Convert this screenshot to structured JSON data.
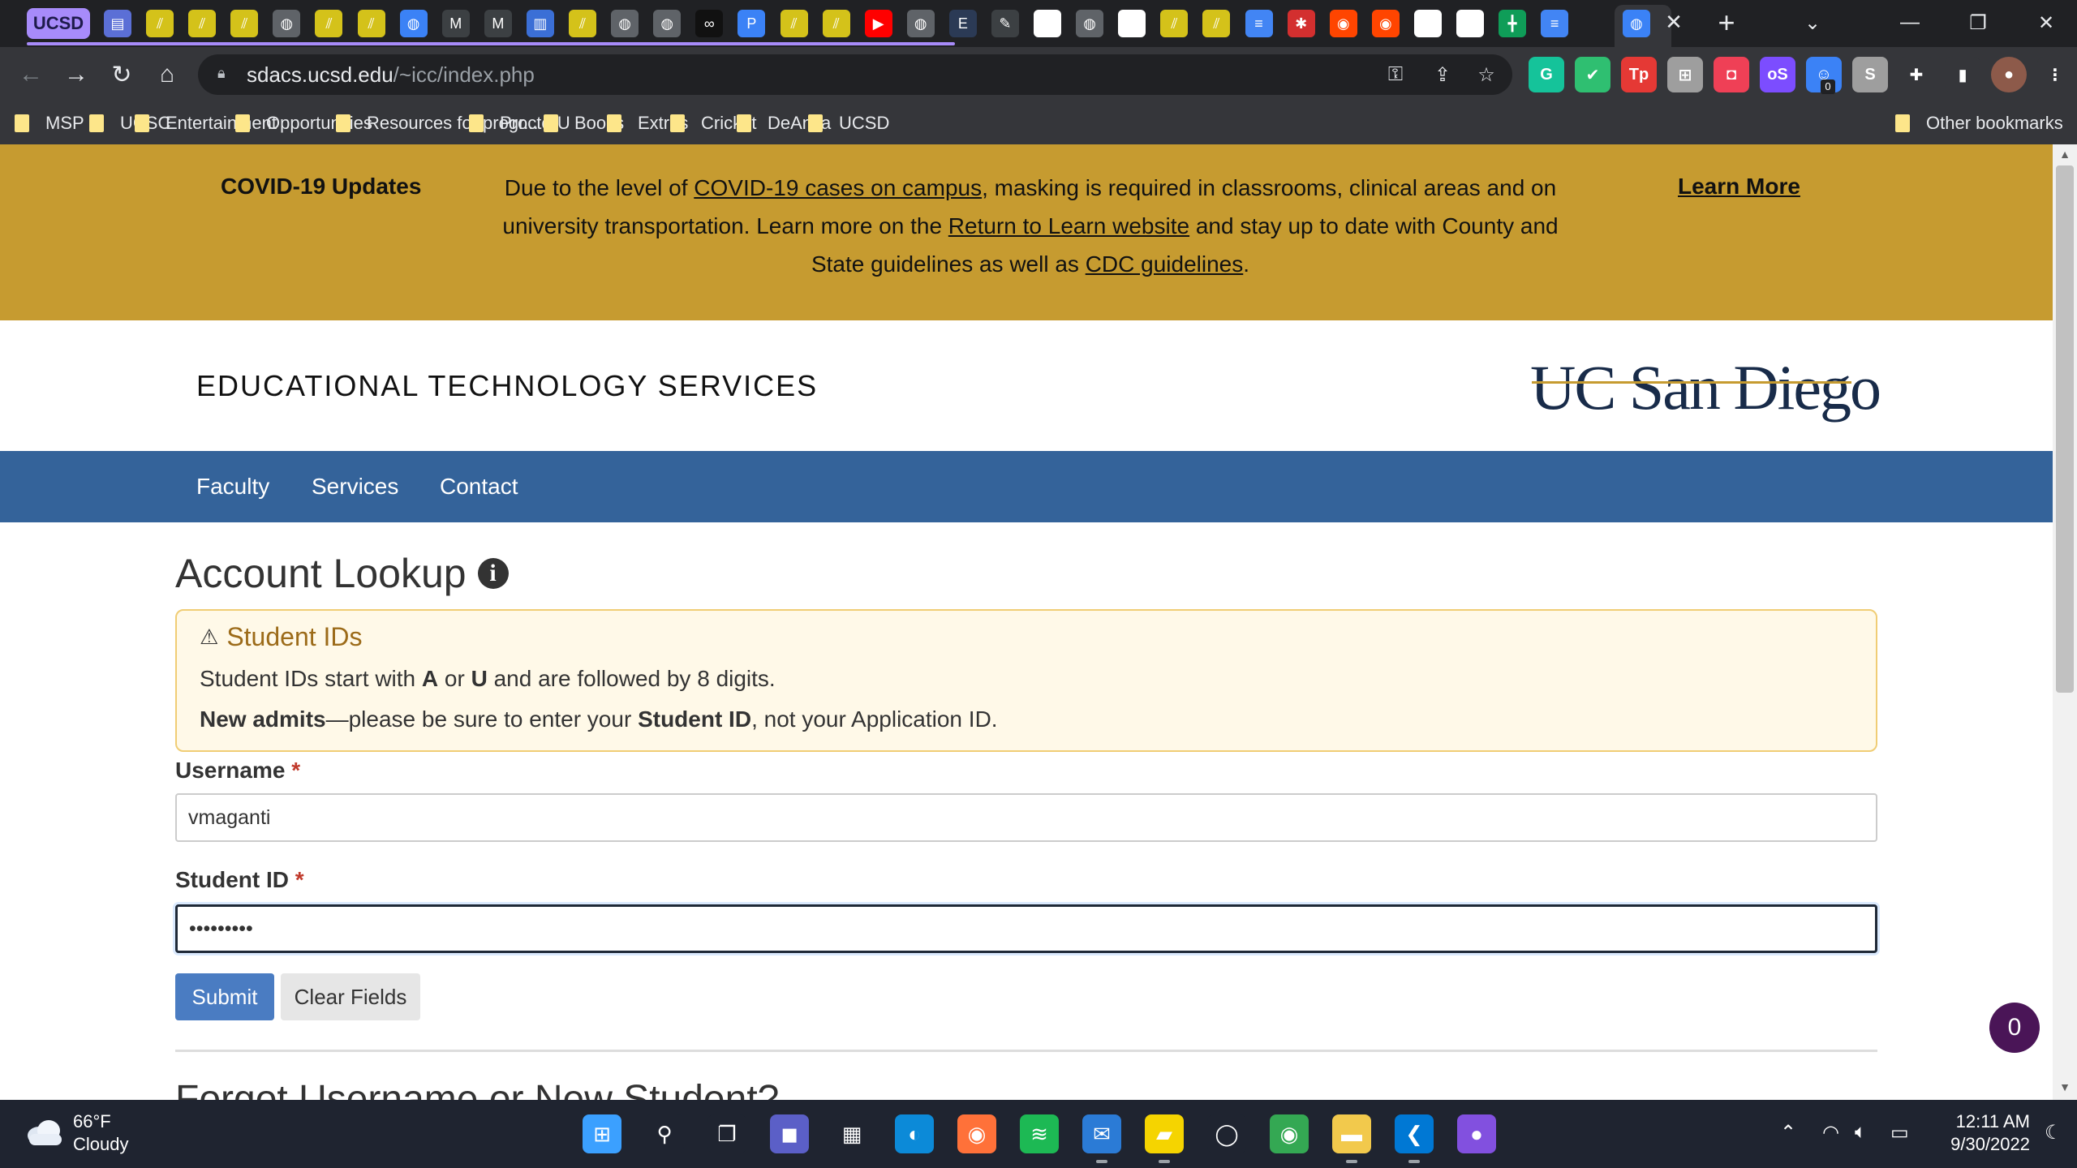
{
  "browser": {
    "tab_group_label": "UCSD",
    "tab_icons": [
      {
        "name": "doc-icon",
        "color": "#5b6fd6",
        "glyph": "▤"
      },
      {
        "name": "striped-icon",
        "color": "#d4c21a",
        "glyph": "⫽"
      },
      {
        "name": "striped-icon",
        "color": "#d4c21a",
        "glyph": "⫽"
      },
      {
        "name": "striped-icon",
        "color": "#d4c21a",
        "glyph": "⫽"
      },
      {
        "name": "globe-icon",
        "color": "#5f6368",
        "glyph": "◍"
      },
      {
        "name": "striped-icon",
        "color": "#d4c21a",
        "glyph": "⫽"
      },
      {
        "name": "striped-icon",
        "color": "#d4c21a",
        "glyph": "⫽"
      },
      {
        "name": "globe-blue-icon",
        "color": "#3b82f6",
        "glyph": "◍"
      },
      {
        "name": "markdown-icon",
        "color": "#3c4043",
        "glyph": "M"
      },
      {
        "name": "markdown-faded-icon",
        "color": "#3c4043",
        "glyph": "M"
      },
      {
        "name": "bar-chart-icon",
        "color": "#3b6fd6",
        "glyph": "▥"
      },
      {
        "name": "striped-icon",
        "color": "#d4c21a",
        "glyph": "⫽"
      },
      {
        "name": "globe-icon",
        "color": "#5f6368",
        "glyph": "◍"
      },
      {
        "name": "globe-icon",
        "color": "#5f6368",
        "glyph": "◍"
      },
      {
        "name": "link-icon",
        "color": "#111111",
        "glyph": "∞"
      },
      {
        "name": "p-icon",
        "color": "#3b82f6",
        "glyph": "P"
      },
      {
        "name": "striped-icon",
        "color": "#d4c21a",
        "glyph": "⫽"
      },
      {
        "name": "striped-icon",
        "color": "#d4c21a",
        "glyph": "⫽"
      },
      {
        "name": "youtube-icon",
        "color": "#ff0000",
        "glyph": "▶"
      },
      {
        "name": "globe-icon",
        "color": "#5f6368",
        "glyph": "◍"
      },
      {
        "name": "ece-ucsd-icon",
        "color": "#2b3a55",
        "glyph": "E"
      },
      {
        "name": "edit-icon",
        "color": "#3c4043",
        "glyph": "✎"
      },
      {
        "name": "github-icon",
        "color": "#ffffff",
        "glyph": "●"
      },
      {
        "name": "globe-icon",
        "color": "#5f6368",
        "glyph": "◍"
      },
      {
        "name": "notion-icon",
        "color": "#ffffff",
        "glyph": "N"
      },
      {
        "name": "striped-icon",
        "color": "#d4c21a",
        "glyph": "⫽"
      },
      {
        "name": "striped-icon",
        "color": "#d4c21a",
        "glyph": "⫽"
      },
      {
        "name": "google-docs-icon",
        "color": "#4285f4",
        "glyph": "≡"
      },
      {
        "name": "red-gear-icon",
        "color": "#d32f2f",
        "glyph": "✱"
      },
      {
        "name": "reddit-icon",
        "color": "#ff4500",
        "glyph": "◉"
      },
      {
        "name": "reddit-icon",
        "color": "#ff4500",
        "glyph": "◉"
      },
      {
        "name": "google-icon",
        "color": "#ffffff",
        "glyph": "G"
      },
      {
        "name": "google-icon",
        "color": "#ffffff",
        "glyph": "G"
      },
      {
        "name": "google-sheets-icon",
        "color": "#0f9d58",
        "glyph": "╋"
      },
      {
        "name": "google-docs-icon",
        "color": "#4285f4",
        "glyph": "≡"
      }
    ],
    "active_tab_icon": {
      "name": "globe-blue-icon",
      "color": "#3b82f6",
      "glyph": "◍"
    },
    "url_host": "sdacs.ucsd.edu",
    "url_path": "/~icc/index.php",
    "extensions": [
      {
        "name": "grammarly-icon",
        "color": "#15c39a",
        "glyph": "G"
      },
      {
        "name": "shield-icon",
        "color": "#2fbf71",
        "glyph": "✔"
      },
      {
        "name": "tp-icon",
        "color": "#e53935",
        "glyph": "Tp"
      },
      {
        "name": "extension-gray-icon",
        "color": "#9e9e9e",
        "glyph": "⊞"
      },
      {
        "name": "pocket-icon",
        "color": "#ef4056",
        "glyph": "◘"
      },
      {
        "name": "os-icon",
        "color": "#7c4dff",
        "glyph": "oS"
      },
      {
        "name": "ghost-icon",
        "color": "#3b82f6",
        "glyph": "☺"
      },
      {
        "name": "s-icon",
        "color": "#9e9e9e",
        "glyph": "S"
      },
      {
        "name": "puzzle-icon",
        "color": "#35363a",
        "glyph": "✚"
      },
      {
        "name": "side-panel-icon",
        "color": "#35363a",
        "glyph": "▮"
      },
      {
        "name": "avatar",
        "color": "#8d5a4a",
        "glyph": "●"
      },
      {
        "name": "kebab-menu-icon",
        "color": "#35363a",
        "glyph": "⋮"
      }
    ],
    "extension_badge": "0",
    "bookmarks": [
      "MSP",
      "UCSC",
      "Entertainment",
      "Opportunities",
      "Resources for progr...",
      "ProctorU",
      "Books",
      "Extras",
      "Cricket",
      "DeAnza",
      "UCSD"
    ],
    "other_bookmarks": "Other bookmarks"
  },
  "banner": {
    "title": "COVID-19 Updates",
    "text_1": "Due to the level of ",
    "link_1": "COVID-19 cases on campus",
    "text_2": ", masking is required in classrooms, clinical areas and on university transportation. Learn more on the ",
    "link_2": "Return to Learn website",
    "text_3": " and stay up to date with County and State guidelines as well as ",
    "link_3": "CDC guidelines",
    "text_4": ".",
    "learn_more": "Learn More"
  },
  "header": {
    "site_title": "EDUCATIONAL TECHNOLOGY SERVICES",
    "logo_text": "UC San Diego"
  },
  "nav": {
    "items": [
      "Faculty",
      "Services",
      "Contact"
    ]
  },
  "main": {
    "title": "Account Lookup",
    "alert": {
      "title": "Student IDs",
      "line1_a": "Student IDs start with ",
      "line1_b": "A",
      "line1_c": " or ",
      "line1_d": "U",
      "line1_e": " and are followed by 8 digits.",
      "line2_a": "New admits",
      "line2_b": "—please be sure to enter your ",
      "line2_c": "Student ID",
      "line2_d": ", not your Application ID."
    },
    "username_label": "Username",
    "username_value": "vmaganti",
    "student_id_label": "Student ID",
    "student_id_value": "•••••••••",
    "required_mark": "*",
    "submit_label": "Submit",
    "clear_label": "Clear Fields",
    "next_section_title": "Forgot Username or New Student?",
    "chat_badge": "0"
  },
  "taskbar": {
    "temperature": "66°F",
    "condition": "Cloudy",
    "apps": [
      {
        "name": "start-icon",
        "color": "#3ba0ff",
        "glyph": "⊞",
        "state": ""
      },
      {
        "name": "search-icon",
        "color": "#1f2430",
        "glyph": "⚲",
        "state": ""
      },
      {
        "name": "task-view-icon",
        "color": "#1f2430",
        "glyph": "❐",
        "state": ""
      },
      {
        "name": "teams-chat-icon",
        "color": "#5b5fc7",
        "glyph": "◼",
        "state": ""
      },
      {
        "name": "store-icon",
        "color": "#1f2430",
        "glyph": "▦",
        "state": ""
      },
      {
        "name": "edge-icon",
        "color": "#0c8ad8",
        "glyph": "◐",
        "state": ""
      },
      {
        "name": "firefox-icon",
        "color": "#ff7139",
        "glyph": "◉",
        "state": ""
      },
      {
        "name": "spotify-icon",
        "color": "#1db954",
        "glyph": "≋",
        "state": ""
      },
      {
        "name": "mail-icon",
        "color": "#2b7bd6",
        "glyph": "✉",
        "state": "running"
      },
      {
        "name": "sticky-notes-icon",
        "color": "#f5d400",
        "glyph": "▰",
        "state": "running"
      },
      {
        "name": "cortana-icon",
        "color": "#1f2430",
        "glyph": "◯",
        "state": ""
      },
      {
        "name": "chrome-icon",
        "color": "#34a853",
        "glyph": "◉",
        "state": "active"
      },
      {
        "name": "file-explorer-icon",
        "color": "#f2c94c",
        "glyph": "▬",
        "state": "running"
      },
      {
        "name": "vscode-icon",
        "color": "#0078d4",
        "glyph": "❮",
        "state": "running"
      },
      {
        "name": "github-desktop-icon",
        "color": "#8250df",
        "glyph": "●",
        "state": ""
      }
    ],
    "time": "12:11 AM",
    "date": "9/30/2022"
  }
}
